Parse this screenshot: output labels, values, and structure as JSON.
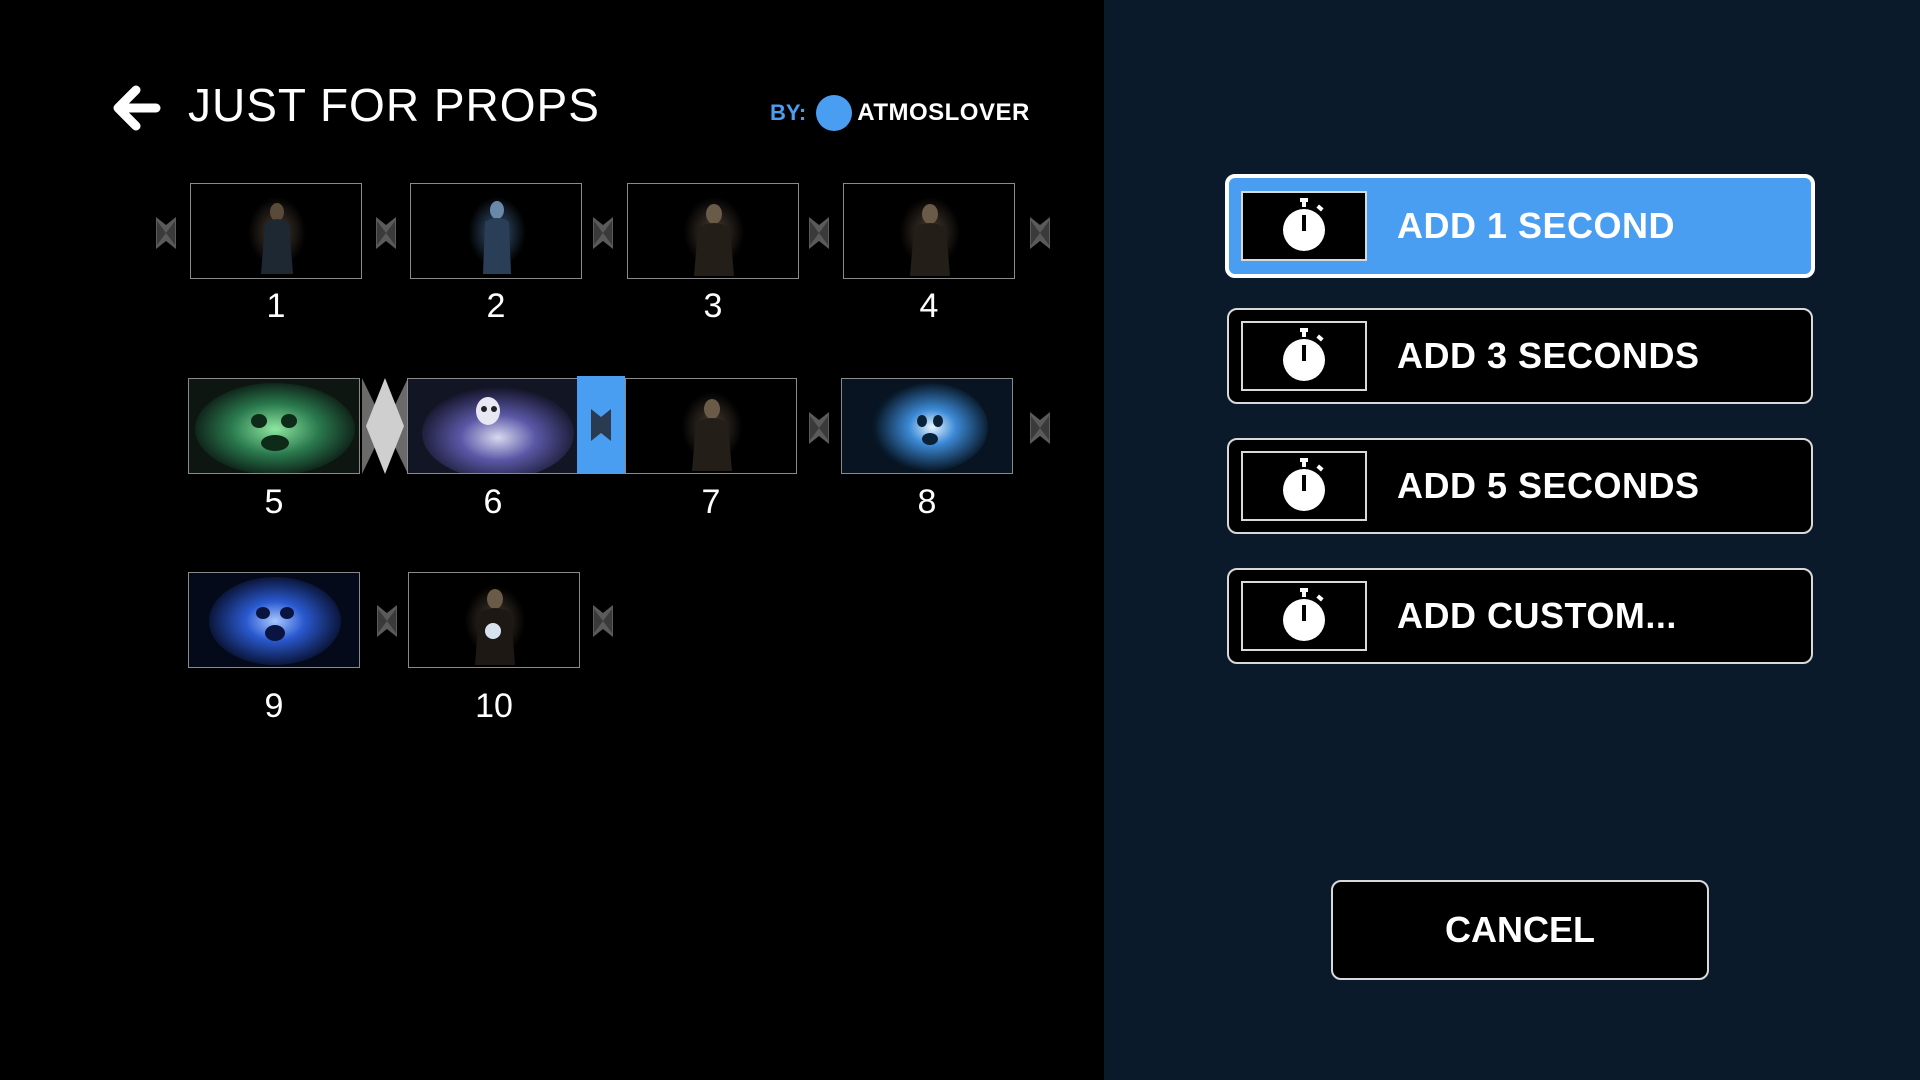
{
  "header": {
    "title": "JUST FOR PROPS",
    "by_label": "BY:",
    "author": "ATMOSLOVER"
  },
  "colors": {
    "accent": "#4a9ef2",
    "right_panel_bg": "#0a1a2b",
    "left_panel_bg": "#000000"
  },
  "clips": [
    {
      "number": "1",
      "theme": "dark-figure"
    },
    {
      "number": "2",
      "theme": "blue-figure"
    },
    {
      "number": "3",
      "theme": "dark-figure"
    },
    {
      "number": "4",
      "theme": "dark-figure"
    },
    {
      "number": "5",
      "theme": "green-ghost"
    },
    {
      "number": "6",
      "theme": "purple-ghost"
    },
    {
      "number": "7",
      "theme": "dark-figure"
    },
    {
      "number": "8",
      "theme": "blue-ghost-face"
    },
    {
      "number": "9",
      "theme": "blue-ghost"
    },
    {
      "number": "10",
      "theme": "figure-with-orb"
    }
  ],
  "options": [
    {
      "label": "ADD 1 SECOND",
      "icon": "stopwatch-icon",
      "selected": true
    },
    {
      "label": "ADD 3 SECONDS",
      "icon": "stopwatch-icon",
      "selected": false
    },
    {
      "label": "ADD 5 SECONDS",
      "icon": "stopwatch-icon",
      "selected": false
    },
    {
      "label": "ADD CUSTOM...",
      "icon": "stopwatch-icon",
      "selected": false
    }
  ],
  "cancel_label": "CANCEL"
}
